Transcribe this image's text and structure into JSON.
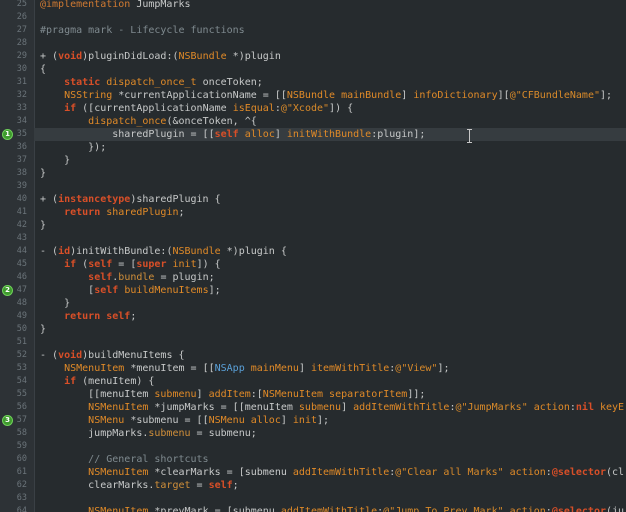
{
  "editor": {
    "first_line_number": 25,
    "current_line": 35,
    "lines": [
      {
        "n": 25,
        "tokens": [
          [
            "ma",
            "@implementation"
          ],
          [
            "pl",
            " JumpMarks"
          ]
        ]
      },
      {
        "n": 26,
        "tokens": []
      },
      {
        "n": 27,
        "tokens": [
          [
            "cm",
            "#pragma mark - Lifecycle functions"
          ]
        ]
      },
      {
        "n": 28,
        "tokens": []
      },
      {
        "n": 29,
        "tokens": [
          [
            "pl",
            "+ ("
          ],
          [
            "kw",
            "void"
          ],
          [
            "pl",
            ")pluginDidLoad:("
          ],
          [
            "ty",
            "NSBundle"
          ],
          [
            "pl",
            " *)plugin"
          ]
        ]
      },
      {
        "n": 30,
        "tokens": [
          [
            "pl",
            "{"
          ]
        ]
      },
      {
        "n": 31,
        "tokens": [
          [
            "pl",
            "    "
          ],
          [
            "kw",
            "static"
          ],
          [
            "pl",
            " "
          ],
          [
            "ty",
            "dispatch_once_t"
          ],
          [
            "pl",
            " onceToken;"
          ]
        ]
      },
      {
        "n": 32,
        "tokens": [
          [
            "pl",
            "    "
          ],
          [
            "ty",
            "NSString"
          ],
          [
            "pl",
            " *currentApplicationName = [["
          ],
          [
            "ty",
            "NSBundle"
          ],
          [
            "pl",
            " "
          ],
          [
            "fn",
            "mainBundle"
          ],
          [
            "pl",
            "] "
          ],
          [
            "fn",
            "infoDictionary"
          ],
          [
            "pl",
            "]["
          ],
          [
            "st",
            "@\"CFBundleName\""
          ],
          [
            "pl",
            "];"
          ]
        ]
      },
      {
        "n": 33,
        "tokens": [
          [
            "pl",
            "    "
          ],
          [
            "kw",
            "if"
          ],
          [
            "pl",
            " ([currentApplicationName "
          ],
          [
            "fn",
            "isEqual"
          ],
          [
            "pl",
            ":"
          ],
          [
            "st",
            "@\"Xcode\""
          ],
          [
            "pl",
            "]) {"
          ]
        ]
      },
      {
        "n": 34,
        "tokens": [
          [
            "pl",
            "        "
          ],
          [
            "fn",
            "dispatch_once"
          ],
          [
            "pl",
            "(&onceToken, ^{"
          ]
        ]
      },
      {
        "n": 35,
        "tokens": [
          [
            "pl",
            "            sharedPlugin = [["
          ],
          [
            "kw",
            "self"
          ],
          [
            "pl",
            " "
          ],
          [
            "fn",
            "alloc"
          ],
          [
            "pl",
            "] "
          ],
          [
            "fn",
            "initWithBundle"
          ],
          [
            "pl",
            ":plugin];"
          ]
        ]
      },
      {
        "n": 36,
        "tokens": [
          [
            "pl",
            "        });"
          ]
        ]
      },
      {
        "n": 37,
        "tokens": [
          [
            "pl",
            "    }"
          ]
        ]
      },
      {
        "n": 38,
        "tokens": [
          [
            "pl",
            "}"
          ]
        ]
      },
      {
        "n": 39,
        "tokens": []
      },
      {
        "n": 40,
        "tokens": [
          [
            "pl",
            "+ ("
          ],
          [
            "kw",
            "instancetype"
          ],
          [
            "pl",
            ")sharedPlugin {"
          ]
        ]
      },
      {
        "n": 41,
        "tokens": [
          [
            "pl",
            "    "
          ],
          [
            "kw",
            "return"
          ],
          [
            "pl",
            " "
          ],
          [
            "fn",
            "sharedPlugin"
          ],
          [
            "pl",
            ";"
          ]
        ]
      },
      {
        "n": 42,
        "tokens": [
          [
            "pl",
            "}"
          ]
        ]
      },
      {
        "n": 43,
        "tokens": []
      },
      {
        "n": 44,
        "tokens": [
          [
            "pl",
            "- ("
          ],
          [
            "kw",
            "id"
          ],
          [
            "pl",
            ")initWithBundle:("
          ],
          [
            "ty",
            "NSBundle"
          ],
          [
            "pl",
            " *)plugin {"
          ]
        ]
      },
      {
        "n": 45,
        "tokens": [
          [
            "pl",
            "    "
          ],
          [
            "kw",
            "if"
          ],
          [
            "pl",
            " ("
          ],
          [
            "kw",
            "self"
          ],
          [
            "pl",
            " = ["
          ],
          [
            "kw",
            "super"
          ],
          [
            "pl",
            " "
          ],
          [
            "fn",
            "init"
          ],
          [
            "pl",
            "]) {"
          ]
        ]
      },
      {
        "n": 46,
        "tokens": [
          [
            "pl",
            "        "
          ],
          [
            "kw",
            "self"
          ],
          [
            "pl",
            "."
          ],
          [
            "pr",
            "bundle"
          ],
          [
            "pl",
            " = plugin;"
          ]
        ]
      },
      {
        "n": 47,
        "tokens": [
          [
            "pl",
            "        ["
          ],
          [
            "kw",
            "self"
          ],
          [
            "pl",
            " "
          ],
          [
            "fn",
            "buildMenuItems"
          ],
          [
            "pl",
            "];"
          ]
        ]
      },
      {
        "n": 48,
        "tokens": [
          [
            "pl",
            "    }"
          ]
        ]
      },
      {
        "n": 49,
        "tokens": [
          [
            "pl",
            "    "
          ],
          [
            "kw",
            "return"
          ],
          [
            "pl",
            " "
          ],
          [
            "kw",
            "self"
          ],
          [
            "pl",
            ";"
          ]
        ]
      },
      {
        "n": 50,
        "tokens": [
          [
            "pl",
            "}"
          ]
        ]
      },
      {
        "n": 51,
        "tokens": []
      },
      {
        "n": 52,
        "tokens": [
          [
            "pl",
            "- ("
          ],
          [
            "kw",
            "void"
          ],
          [
            "pl",
            ")buildMenuItems {"
          ]
        ]
      },
      {
        "n": 53,
        "tokens": [
          [
            "pl",
            "    "
          ],
          [
            "ty",
            "NSMenuItem"
          ],
          [
            "pl",
            " *menuItem = [["
          ],
          [
            "cl",
            "NSApp"
          ],
          [
            "pl",
            " "
          ],
          [
            "fn",
            "mainMenu"
          ],
          [
            "pl",
            "] "
          ],
          [
            "fn",
            "itemWithTitle"
          ],
          [
            "pl",
            ":"
          ],
          [
            "st",
            "@\"View\""
          ],
          [
            "pl",
            "];"
          ]
        ]
      },
      {
        "n": 54,
        "tokens": [
          [
            "pl",
            "    "
          ],
          [
            "kw",
            "if"
          ],
          [
            "pl",
            " (menuItem) {"
          ]
        ]
      },
      {
        "n": 55,
        "tokens": [
          [
            "pl",
            "        [[menuItem "
          ],
          [
            "fn",
            "submenu"
          ],
          [
            "pl",
            "] "
          ],
          [
            "fn",
            "addItem"
          ],
          [
            "pl",
            ":["
          ],
          [
            "ty",
            "NSMenuItem"
          ],
          [
            "pl",
            " "
          ],
          [
            "fn",
            "separatorItem"
          ],
          [
            "pl",
            "]];"
          ]
        ]
      },
      {
        "n": 56,
        "tokens": [
          [
            "pl",
            "        "
          ],
          [
            "ty",
            "NSMenuItem"
          ],
          [
            "pl",
            " *jumpMarks = [[menuItem "
          ],
          [
            "fn",
            "submenu"
          ],
          [
            "pl",
            "] "
          ],
          [
            "fn",
            "addItemWithTitle"
          ],
          [
            "pl",
            ":"
          ],
          [
            "st",
            "@\"JumpMarks\""
          ],
          [
            "pl",
            " "
          ],
          [
            "fn",
            "action"
          ],
          [
            "pl",
            ":"
          ],
          [
            "kw",
            "nil"
          ],
          [
            "pl",
            " "
          ],
          [
            "fn",
            "keyE"
          ]
        ]
      },
      {
        "n": 57,
        "tokens": [
          [
            "pl",
            "        "
          ],
          [
            "ty",
            "NSMenu"
          ],
          [
            "pl",
            " *submenu = [["
          ],
          [
            "ty",
            "NSMenu"
          ],
          [
            "pl",
            " "
          ],
          [
            "fn",
            "alloc"
          ],
          [
            "pl",
            "] "
          ],
          [
            "fn",
            "init"
          ],
          [
            "pl",
            "];"
          ]
        ]
      },
      {
        "n": 58,
        "tokens": [
          [
            "pl",
            "        jumpMarks."
          ],
          [
            "pr",
            "submenu"
          ],
          [
            "pl",
            " = submenu;"
          ]
        ]
      },
      {
        "n": 59,
        "tokens": []
      },
      {
        "n": 60,
        "tokens": [
          [
            "pl",
            "        "
          ],
          [
            "cm",
            "// General shortcuts"
          ]
        ]
      },
      {
        "n": 61,
        "tokens": [
          [
            "pl",
            "        "
          ],
          [
            "ty",
            "NSMenuItem"
          ],
          [
            "pl",
            " *clearMarks = [submenu "
          ],
          [
            "fn",
            "addItemWithTitle"
          ],
          [
            "pl",
            ":"
          ],
          [
            "st",
            "@\"Clear all Marks\""
          ],
          [
            "pl",
            " "
          ],
          [
            "fn",
            "action"
          ],
          [
            "pl",
            ":"
          ],
          [
            "kw",
            "@selector"
          ],
          [
            "pl",
            "(cl"
          ]
        ]
      },
      {
        "n": 62,
        "tokens": [
          [
            "pl",
            "        clearMarks."
          ],
          [
            "pr",
            "target"
          ],
          [
            "pl",
            " = "
          ],
          [
            "kw",
            "self"
          ],
          [
            "pl",
            ";"
          ]
        ]
      },
      {
        "n": 63,
        "tokens": []
      },
      {
        "n": 64,
        "tokens": [
          [
            "pl",
            "        "
          ],
          [
            "ty",
            "NSMenuItem"
          ],
          [
            "pl",
            " *prevMark = [submenu "
          ],
          [
            "fn",
            "addItemWithTitle"
          ],
          [
            "pl",
            ":"
          ],
          [
            "st",
            "@\"Jump To Prev Mark\""
          ],
          [
            "pl",
            " "
          ],
          [
            "fn",
            "action"
          ],
          [
            "pl",
            ":"
          ],
          [
            "kw",
            "@selector"
          ],
          [
            "pl",
            "(ju"
          ]
        ]
      }
    ],
    "jump_marks": [
      {
        "line": 35,
        "label": "1"
      },
      {
        "line": 47,
        "label": "2"
      },
      {
        "line": 57,
        "label": "3"
      }
    ]
  }
}
